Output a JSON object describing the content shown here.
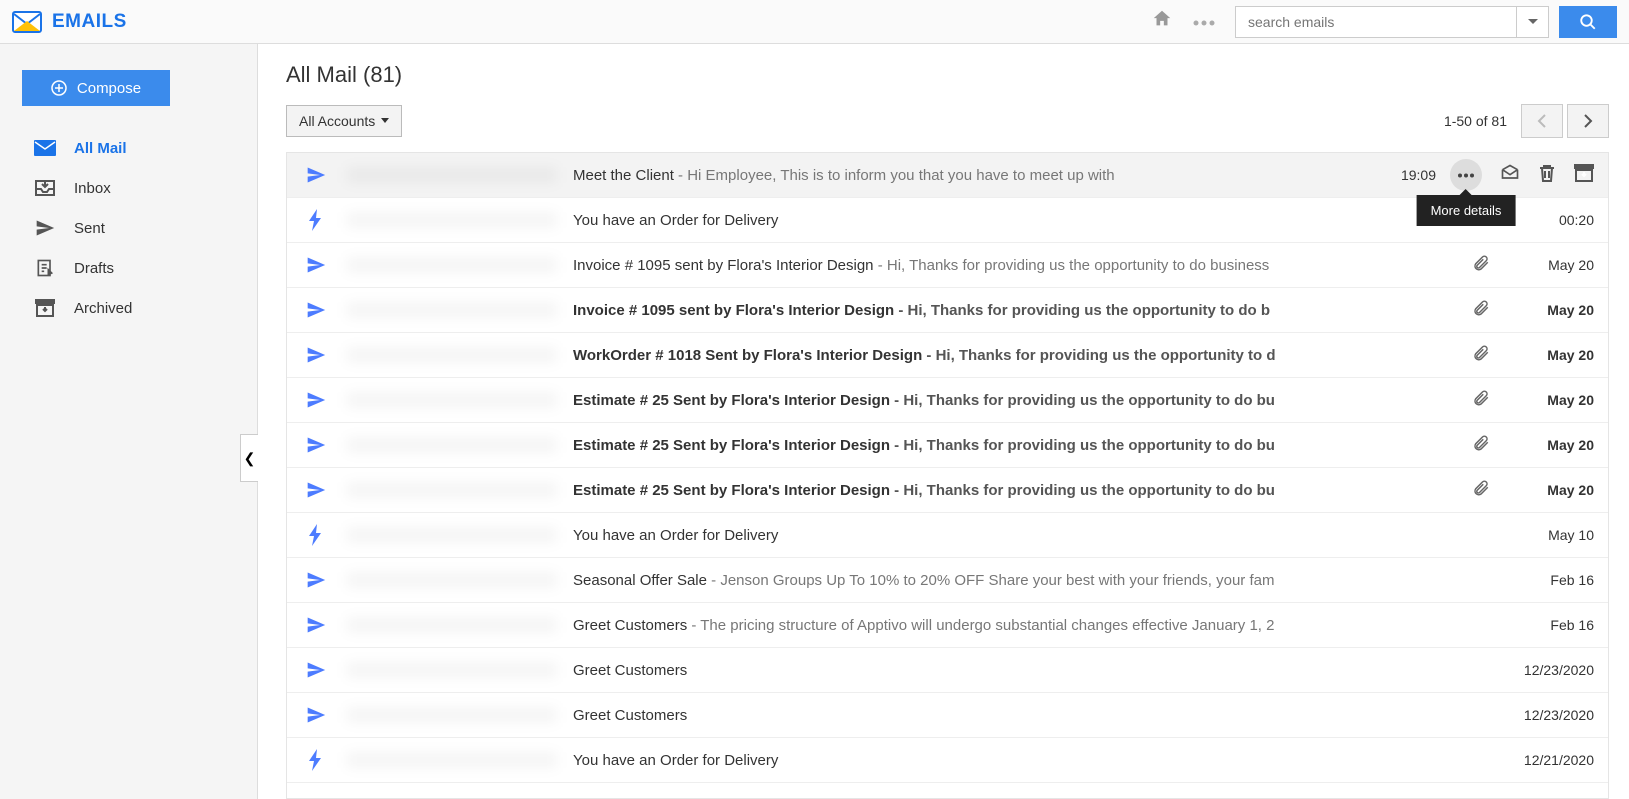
{
  "app": {
    "logo_text": "EMAILS"
  },
  "search": {
    "placeholder": "search emails"
  },
  "sidebar": {
    "compose": "Compose",
    "items": [
      {
        "label": "All Mail",
        "icon": "envelope",
        "active": true
      },
      {
        "label": "Inbox",
        "icon": "inbox",
        "active": false
      },
      {
        "label": "Sent",
        "icon": "plane",
        "active": false
      },
      {
        "label": "Drafts",
        "icon": "draft",
        "active": false
      },
      {
        "label": "Archived",
        "icon": "archive",
        "active": false
      }
    ]
  },
  "main": {
    "title": "All Mail (81)",
    "accounts_label": "All Accounts",
    "paging": "1-50 of 81"
  },
  "tooltip": {
    "more": "More details"
  },
  "emails": [
    {
      "icon": "plane",
      "subject": "Meet the Client",
      "preview": " - Hi Employee, This is to inform you that you have to meet up with",
      "date": "19:09",
      "unread": false,
      "attach": false,
      "hover": true
    },
    {
      "icon": "bolt",
      "subject": "You have an Order for Delivery",
      "preview": "",
      "date": "00:20",
      "unread": false,
      "attach": false
    },
    {
      "icon": "plane",
      "subject": "Invoice # 1095 sent by Flora's Interior Design",
      "preview": " - Hi,  Thanks for providing us the opportunity to do business",
      "date": "May 20",
      "unread": false,
      "attach": true
    },
    {
      "icon": "plane",
      "subject": "Invoice # 1095 sent by Flora's Interior Design",
      "preview": " - Hi,  Thanks for providing us the opportunity to do b",
      "date": "May 20",
      "unread": true,
      "attach": true
    },
    {
      "icon": "plane",
      "subject": "WorkOrder # 1018 Sent by Flora's Interior Design",
      "preview": " - Hi, Thanks for providing us the opportunity to d",
      "date": "May 20",
      "unread": true,
      "attach": true
    },
    {
      "icon": "plane",
      "subject": "Estimate # 25 Sent by Flora's Interior Design",
      "preview": " - Hi,  Thanks for providing us the opportunity to do bu",
      "date": "May 20",
      "unread": true,
      "attach": true
    },
    {
      "icon": "plane",
      "subject": "Estimate # 25 Sent by Flora's Interior Design",
      "preview": " - Hi,  Thanks for providing us the opportunity to do bu",
      "date": "May 20",
      "unread": true,
      "attach": true
    },
    {
      "icon": "plane",
      "subject": "Estimate # 25 Sent by Flora's Interior Design",
      "preview": " - Hi,  Thanks for providing us the opportunity to do bu",
      "date": "May 20",
      "unread": true,
      "attach": true
    },
    {
      "icon": "bolt",
      "subject": "You have an Order for Delivery",
      "preview": "",
      "date": "May 10",
      "unread": false,
      "attach": false
    },
    {
      "icon": "plane",
      "subject": "Seasonal Offer Sale",
      "preview": " - Jenson Groups Up To 10% to 20% OFF Share your best with your friends, your fam",
      "date": "Feb 16",
      "unread": false,
      "attach": false
    },
    {
      "icon": "plane",
      "subject": "Greet Customers",
      "preview": " - The pricing structure of Apptivo will undergo substantial changes effective January 1, 2",
      "date": "Feb 16",
      "unread": false,
      "attach": false
    },
    {
      "icon": "plane",
      "subject": "Greet Customers",
      "preview": "",
      "date": "12/23/2020",
      "unread": false,
      "attach": false
    },
    {
      "icon": "plane",
      "subject": "Greet Customers",
      "preview": "",
      "date": "12/23/2020",
      "unread": false,
      "attach": false
    },
    {
      "icon": "bolt",
      "subject": "You have an Order for Delivery",
      "preview": "",
      "date": "12/21/2020",
      "unread": false,
      "attach": false
    }
  ]
}
